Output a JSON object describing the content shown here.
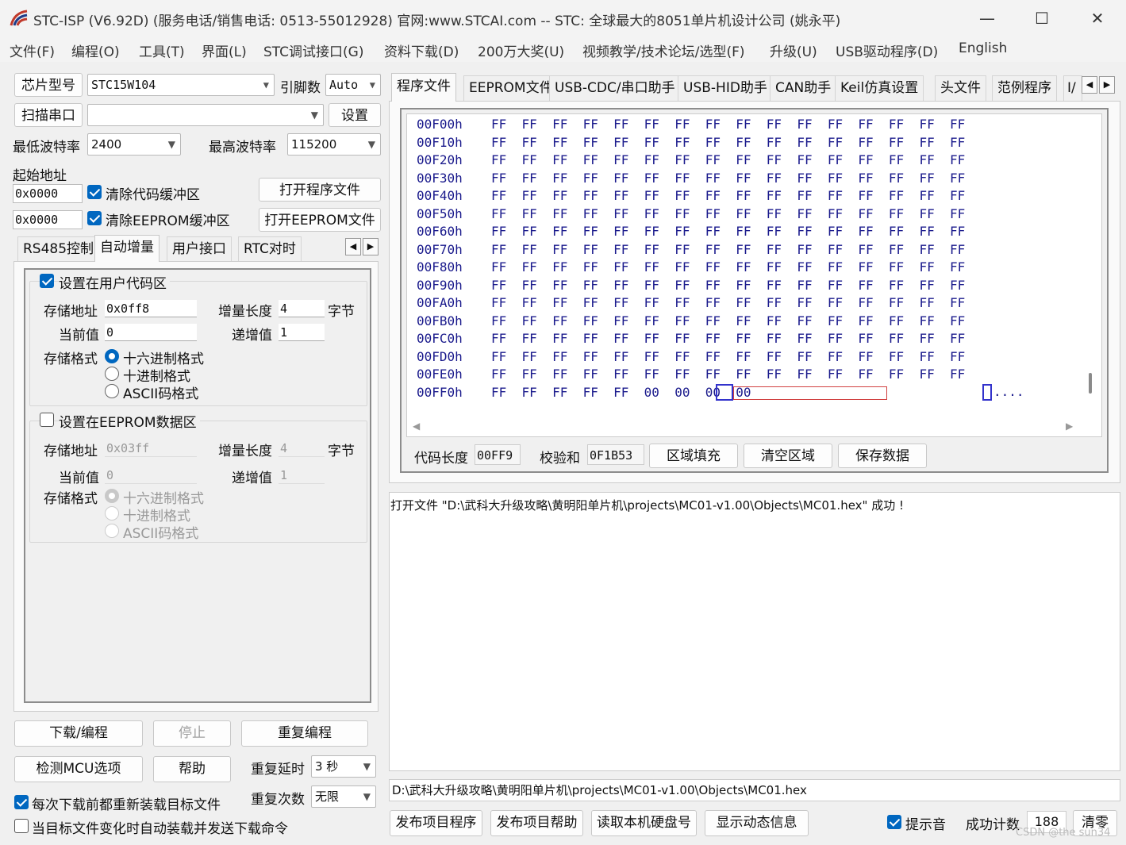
{
  "title": {
    "text": "STC-ISP (V6.92D) (服务电话/销售电话: 0513-55012928) 官网:www.STCAI.com  -- STC: 全球最大的8051单片机设计公司 (姚永平)"
  },
  "window_controls": {
    "minimize": "—",
    "maximize": "☐",
    "close": "✕"
  },
  "menu": [
    "文件(F)",
    "编程(O)",
    "工具(T)",
    "界面(L)",
    "STC调试接口(G)",
    "资料下载(D)",
    "200万大奖(U)",
    "视频教学/技术论坛/选型(F)",
    "升级(U)",
    "USB驱动程序(D)",
    "English"
  ],
  "left": {
    "chip_btn": "芯片型号",
    "chip_value": "STC15W104",
    "pins_label": "引脚数",
    "pins_value": "Auto",
    "scan_btn": "扫描串口",
    "port_value": "",
    "settings_btn": "设置",
    "min_baud_label": "最低波特率",
    "min_baud_value": "2400",
    "max_baud_label": "最高波特率",
    "max_baud_value": "115200",
    "start_addr_label": "起始地址",
    "addr1": "0x0000",
    "clear_code_label": "清除代码缓冲区",
    "open_prog_btn": "打开程序文件",
    "addr2": "0x0000",
    "clear_eeprom_label": "清除EEPROM缓冲区",
    "open_eeprom_btn": "打开EEPROM文件",
    "tabs": [
      "RS485控制",
      "自动增量",
      "用户接口",
      "RTC对时"
    ],
    "g1": {
      "title": "设置在用户代码区",
      "store_addr_label": "存储地址",
      "store_addr": "0x0ff8",
      "inc_len_label": "增量长度",
      "inc_len": "4",
      "unit": "字节",
      "cur_label": "当前值",
      "cur": "0",
      "step_label": "递增值",
      "step": "1",
      "fmt_label": "存储格式",
      "fmt": [
        "十六进制格式",
        "十进制格式",
        "ASCII码格式"
      ]
    },
    "g2": {
      "title": "设置在EEPROM数据区",
      "store_addr_label": "存储地址",
      "store_addr": "0x03ff",
      "inc_len_label": "增量长度",
      "inc_len": "4",
      "unit": "字节",
      "cur_label": "当前值",
      "cur": "0",
      "step_label": "递增值",
      "step": "1",
      "fmt_label": "存储格式",
      "fmt": [
        "十六进制格式",
        "十进制格式",
        "ASCII码格式"
      ]
    },
    "download_btn": "下载/编程",
    "stop_btn": "停止",
    "reprog_btn": "重复编程",
    "check_mcu_btn": "检测MCU选项",
    "help_btn": "帮助",
    "delay_label": "重复延时",
    "delay_value": "3 秒",
    "count_label": "重复次数",
    "count_value": "无限",
    "reload_label": "每次下载前都重新装载目标文件",
    "auto_label": "当目标文件变化时自动装载并发送下载命令"
  },
  "right": {
    "tabs": [
      "程序文件",
      "EEPROM文件",
      "USB-CDC/串口助手",
      "USB-HID助手",
      "CAN助手",
      "Keil仿真设置",
      "头文件",
      "范例程序",
      "I/"
    ],
    "hex_rows": [
      {
        "addr": "00F00h",
        "bytes": "FF  FF  FF  FF  FF  FF  FF  FF  FF  FF  FF  FF  FF  FF  FF  FF"
      },
      {
        "addr": "00F10h",
        "bytes": "FF  FF  FF  FF  FF  FF  FF  FF  FF  FF  FF  FF  FF  FF  FF  FF"
      },
      {
        "addr": "00F20h",
        "bytes": "FF  FF  FF  FF  FF  FF  FF  FF  FF  FF  FF  FF  FF  FF  FF  FF"
      },
      {
        "addr": "00F30h",
        "bytes": "FF  FF  FF  FF  FF  FF  FF  FF  FF  FF  FF  FF  FF  FF  FF  FF"
      },
      {
        "addr": "00F40h",
        "bytes": "FF  FF  FF  FF  FF  FF  FF  FF  FF  FF  FF  FF  FF  FF  FF  FF"
      },
      {
        "addr": "00F50h",
        "bytes": "FF  FF  FF  FF  FF  FF  FF  FF  FF  FF  FF  FF  FF  FF  FF  FF"
      },
      {
        "addr": "00F60h",
        "bytes": "FF  FF  FF  FF  FF  FF  FF  FF  FF  FF  FF  FF  FF  FF  FF  FF"
      },
      {
        "addr": "00F70h",
        "bytes": "FF  FF  FF  FF  FF  FF  FF  FF  FF  FF  FF  FF  FF  FF  FF  FF"
      },
      {
        "addr": "00F80h",
        "bytes": "FF  FF  FF  FF  FF  FF  FF  FF  FF  FF  FF  FF  FF  FF  FF  FF"
      },
      {
        "addr": "00F90h",
        "bytes": "FF  FF  FF  FF  FF  FF  FF  FF  FF  FF  FF  FF  FF  FF  FF  FF"
      },
      {
        "addr": "00FA0h",
        "bytes": "FF  FF  FF  FF  FF  FF  FF  FF  FF  FF  FF  FF  FF  FF  FF  FF"
      },
      {
        "addr": "00FB0h",
        "bytes": "FF  FF  FF  FF  FF  FF  FF  FF  FF  FF  FF  FF  FF  FF  FF  FF"
      },
      {
        "addr": "00FC0h",
        "bytes": "FF  FF  FF  FF  FF  FF  FF  FF  FF  FF  FF  FF  FF  FF  FF  FF"
      },
      {
        "addr": "00FD0h",
        "bytes": "FF  FF  FF  FF  FF  FF  FF  FF  FF  FF  FF  FF  FF  FF  FF  FF"
      },
      {
        "addr": "00FE0h",
        "bytes": "FF  FF  FF  FF  FF  FF  FF  FF  FF  FF  FF  FF  FF  FF  FF  FF"
      },
      {
        "addr": "00FF0h",
        "bytes": "FF  FF  FF  FF  FF  00  00  00  00"
      }
    ],
    "ascii_tail": "....",
    "code_len_label": "代码长度",
    "code_len": "00FF9",
    "checksum_label": "校验和",
    "checksum": "0F1B53",
    "fill_btn": "区域填充",
    "clear_btn": "清空区域",
    "save_btn": "保存数据",
    "log": "打开文件 \"D:\\武科大升级攻略\\黄明阳单片机\\projects\\MC01-v1.00\\Objects\\MC01.hex\" 成功 !",
    "path": "D:\\武科大升级攻略\\黄明阳单片机\\projects\\MC01-v1.00\\Objects\\MC01.hex",
    "publish_prog_btn": "发布项目程序",
    "publish_help_btn": "发布项目帮助",
    "read_disk_btn": "读取本机硬盘号",
    "show_info_btn": "显示动态信息",
    "sound_label": "提示音",
    "success_label": "成功计数",
    "success_count": "188",
    "reset_btn": "清零",
    "watermark": "CSDN @the sun34"
  }
}
